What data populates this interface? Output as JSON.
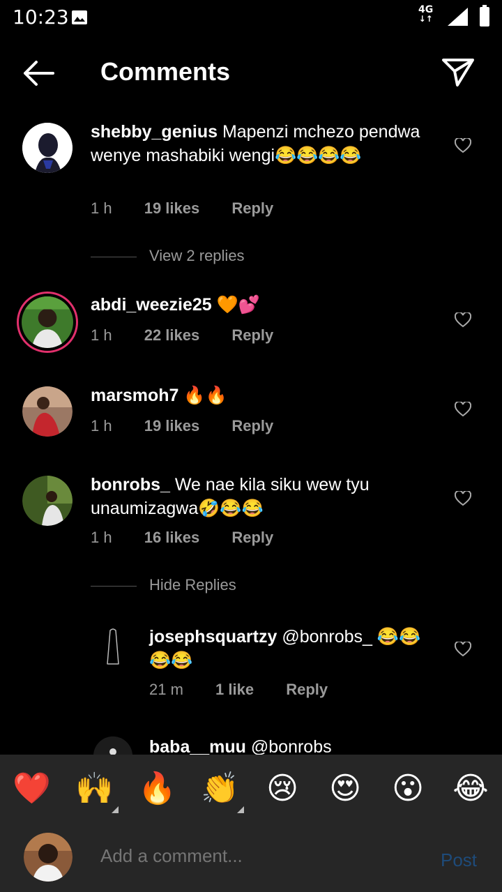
{
  "status": {
    "time": "10:23",
    "network": "4G"
  },
  "header": {
    "title": "Comments"
  },
  "comments": [
    {
      "username": "shebby_genius",
      "text": "Mapenzi mchezo pendwa wenye mashabiki wengi😂😂😂😂",
      "time": "1 h",
      "likes": "19 likes",
      "reply": "Reply",
      "toggle": "View 2 replies"
    },
    {
      "username": "abdi_weezie25",
      "text": "🧡💕",
      "time": "1 h",
      "likes": "22 likes",
      "reply": "Reply"
    },
    {
      "username": "marsmoh7",
      "text": "🔥🔥",
      "time": "1 h",
      "likes": "19 likes",
      "reply": "Reply"
    },
    {
      "username": "bonrobs_",
      "text": "We nae kila siku wew tyu unaumizagwa🤣😂😂",
      "time": "1 h",
      "likes": "16 likes",
      "reply": "Reply",
      "toggle": "Hide Replies"
    }
  ],
  "replies": [
    {
      "username": "josephsquartzy",
      "text": "@bonrobs_ 😂😂😂😂",
      "time": "21 m",
      "likes": "1 like",
      "reply": "Reply"
    },
    {
      "username": "baba__muu",
      "text": "@bonrobs_"
    }
  ],
  "emoji_bar": [
    "❤️",
    "🙌",
    "🔥",
    "👏",
    "😢",
    "😍",
    "😮",
    "😂"
  ],
  "composer": {
    "placeholder": "Add a comment...",
    "post_label": "Post"
  },
  "colors": {
    "post_disabled": "#1e4b7a",
    "ring": "#e1306c",
    "bar": "#262626"
  }
}
